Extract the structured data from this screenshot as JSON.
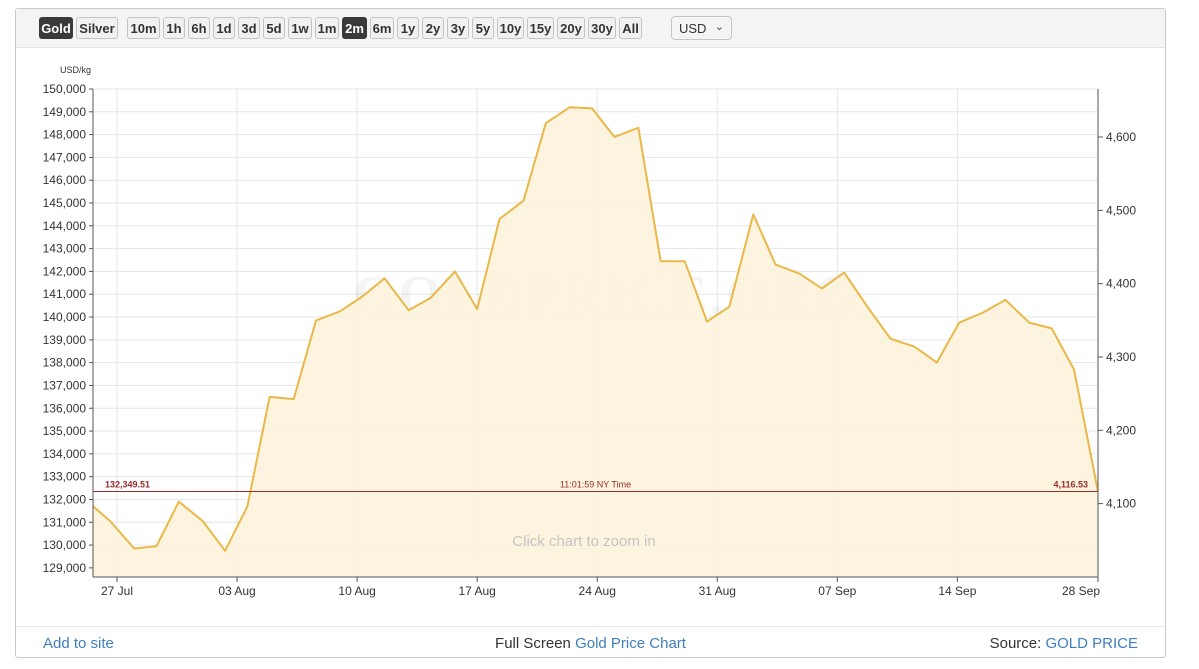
{
  "toolbar": {
    "metals": [
      {
        "label": "Gold",
        "active": true
      },
      {
        "label": "Silver",
        "active": false
      }
    ],
    "ranges": [
      {
        "label": "10m",
        "active": false
      },
      {
        "label": "1h",
        "active": false
      },
      {
        "label": "6h",
        "active": false
      },
      {
        "label": "1d",
        "active": false
      },
      {
        "label": "3d",
        "active": false
      },
      {
        "label": "5d",
        "active": false
      },
      {
        "label": "1w",
        "active": false
      },
      {
        "label": "1m",
        "active": false
      },
      {
        "label": "2m",
        "active": true
      },
      {
        "label": "6m",
        "active": false
      },
      {
        "label": "1y",
        "active": false
      },
      {
        "label": "2y",
        "active": false
      },
      {
        "label": "3y",
        "active": false
      },
      {
        "label": "5y",
        "active": false
      },
      {
        "label": "10y",
        "active": false
      },
      {
        "label": "15y",
        "active": false
      },
      {
        "label": "20y",
        "active": false
      },
      {
        "label": "30y",
        "active": false
      },
      {
        "label": "All",
        "active": false
      }
    ],
    "currency": "USD"
  },
  "chart_data": {
    "type": "area",
    "unit_label": "USD/kg",
    "watermark": "GOLDPRICE.ORG",
    "hint": "Click chart to zoom in",
    "x_tick_labels": [
      "27 Jul",
      "03 Aug",
      "10 Aug",
      "17 Aug",
      "24 Aug",
      "31 Aug",
      "07 Sep",
      "14 Sep",
      "28 Sep"
    ],
    "y_left": {
      "min": 128600,
      "max": 150000,
      "ticks": [
        129000,
        130000,
        131000,
        132000,
        133000,
        134000,
        135000,
        136000,
        137000,
        138000,
        139000,
        140000,
        141000,
        142000,
        143000,
        144000,
        145000,
        146000,
        147000,
        148000,
        149000,
        150000
      ]
    },
    "y_right": {
      "ticks": [
        4100,
        4200,
        4300,
        4400,
        4500,
        4600
      ]
    },
    "series": [
      {
        "color": "#e9b849",
        "fill": "#fcf3da",
        "points": [
          [
            "Jul 25.6",
            131700
          ],
          [
            "Jul 26.6",
            131050
          ],
          [
            "Jul 28.0",
            129850
          ],
          [
            "Jul 29.3",
            129950
          ],
          [
            "Jul 30.6",
            131900
          ],
          [
            "Aug 1.0",
            131050
          ],
          [
            "Aug 2.3",
            129750
          ],
          [
            "Aug 3.6",
            131700
          ],
          [
            "Aug 4.9",
            136500
          ],
          [
            "Aug 6.3",
            136400
          ],
          [
            "Aug 7.6",
            139850
          ],
          [
            "Aug 9.0",
            140250
          ],
          [
            "Aug 10.3",
            140900
          ],
          [
            "Aug 11.6",
            141700
          ],
          [
            "Aug 13.0",
            140300
          ],
          [
            "Aug 14.3",
            140850
          ],
          [
            "Aug 15.7",
            142000
          ],
          [
            "Aug 17.0",
            140350
          ],
          [
            "Aug 18.3",
            144300
          ],
          [
            "Aug 19.7",
            145100
          ],
          [
            "Aug 21.0",
            148500
          ],
          [
            "Aug 22.4",
            149200
          ],
          [
            "Aug 23.7",
            149150
          ],
          [
            "Aug 25.0",
            147900
          ],
          [
            "Aug 26.4",
            148300
          ],
          [
            "Aug 27.7",
            142450
          ],
          [
            "Aug 29.1",
            142450
          ],
          [
            "Aug 30.4",
            139800
          ],
          [
            "Aug 31.7",
            140450
          ],
          [
            "Sep 2.1",
            144500
          ],
          [
            "Sep 3.4",
            142300
          ],
          [
            "Sep 4.8",
            141900
          ],
          [
            "Sep 6.1",
            141250
          ],
          [
            "Sep 7.4",
            141950
          ],
          [
            "Sep 8.8",
            140400
          ],
          [
            "Sep 10.1",
            139050
          ],
          [
            "Sep 11.5",
            138700
          ],
          [
            "Sep 12.8",
            138000
          ],
          [
            "Sep 14.1",
            139750
          ],
          [
            "Sep 15.5",
            140200
          ],
          [
            "Sep 16.8",
            140750
          ],
          [
            "Sep 18.2",
            139750
          ],
          [
            "Sep 19.5",
            139500
          ],
          [
            "Sep 20.8",
            137700
          ],
          [
            "Sep 22.2",
            132349.51
          ]
        ]
      }
    ],
    "current": {
      "left_label": "132,349.51",
      "time_label": "11:01:59 NY Time",
      "right_label": "4,116.53",
      "color": "#9c2b2b"
    }
  },
  "footer": {
    "add_to_site": "Add to site",
    "full_screen_prefix": "Full Screen ",
    "full_screen_link": "Gold Price Chart",
    "source_prefix": "Source: ",
    "source_link": "GOLD PRICE"
  }
}
